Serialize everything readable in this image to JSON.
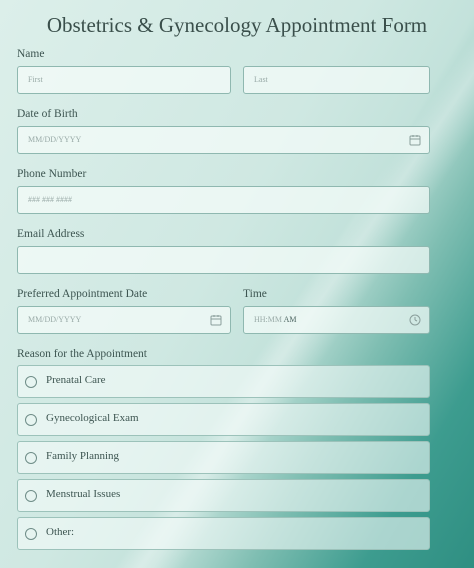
{
  "form": {
    "title": "Obstetrics & Gynecology Appointment Form",
    "name_label": "Name",
    "first_placeholder": "First",
    "last_placeholder": "Last",
    "dob_label": "Date of Birth",
    "dob_placeholder": "MM/DD/YYYY",
    "phone_label": "Phone Number",
    "phone_placeholder": "### ### ####",
    "email_label": "Email Address",
    "email_value": "",
    "appt_date_label": "Preferred Appointment Date",
    "appt_date_placeholder": "MM/DD/YYYY",
    "time_label": "Time",
    "time_placeholder_hm": "HH:MM",
    "time_ampm": "AM",
    "reason_label": "Reason for the Appointment",
    "reasons": [
      "Prenatal Care",
      "Gynecological Exam",
      "Family Planning",
      "Menstrual Issues",
      "Other:"
    ]
  },
  "icons": {
    "calendar": "calendar-icon",
    "clock": "clock-icon",
    "radio": "radio-circle"
  },
  "colors": {
    "accent": "#2f8f82",
    "border": "#8fb8b0"
  }
}
